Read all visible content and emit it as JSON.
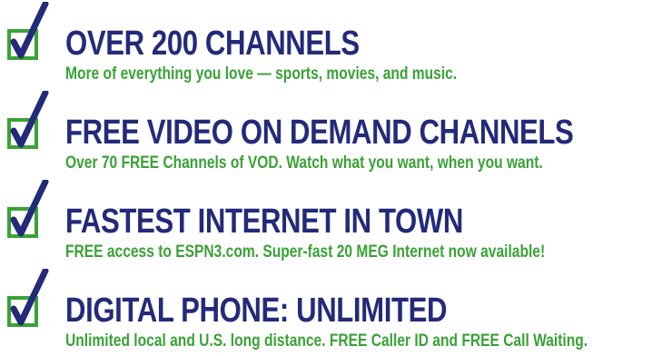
{
  "features": [
    {
      "headline": "OVER 200 CHANNELS",
      "subline": "More of everything you love — sports, movies, and music.",
      "icon": "checkbox-checked-icon"
    },
    {
      "headline": "FREE VIDEO ON DEMAND CHANNELS",
      "subline": "Over 70 FREE Channels of VOD. Watch what you want, when you want.",
      "icon": "checkbox-checked-icon"
    },
    {
      "headline": "FASTEST INTERNET IN TOWN",
      "subline": "FREE access to ESPN3.com. Super-fast 20 MEG Internet now available!",
      "icon": "checkbox-checked-icon"
    },
    {
      "headline": "DIGITAL PHONE: UNLIMITED",
      "subline": "Unlimited local and U.S. long distance. FREE Caller ID and FREE Call Waiting.",
      "icon": "checkbox-checked-icon"
    }
  ],
  "colors": {
    "headline": "#232a7a",
    "subline": "#3aa236",
    "checkbox_border": "#3aa236",
    "checkmark": "#232a7a"
  }
}
